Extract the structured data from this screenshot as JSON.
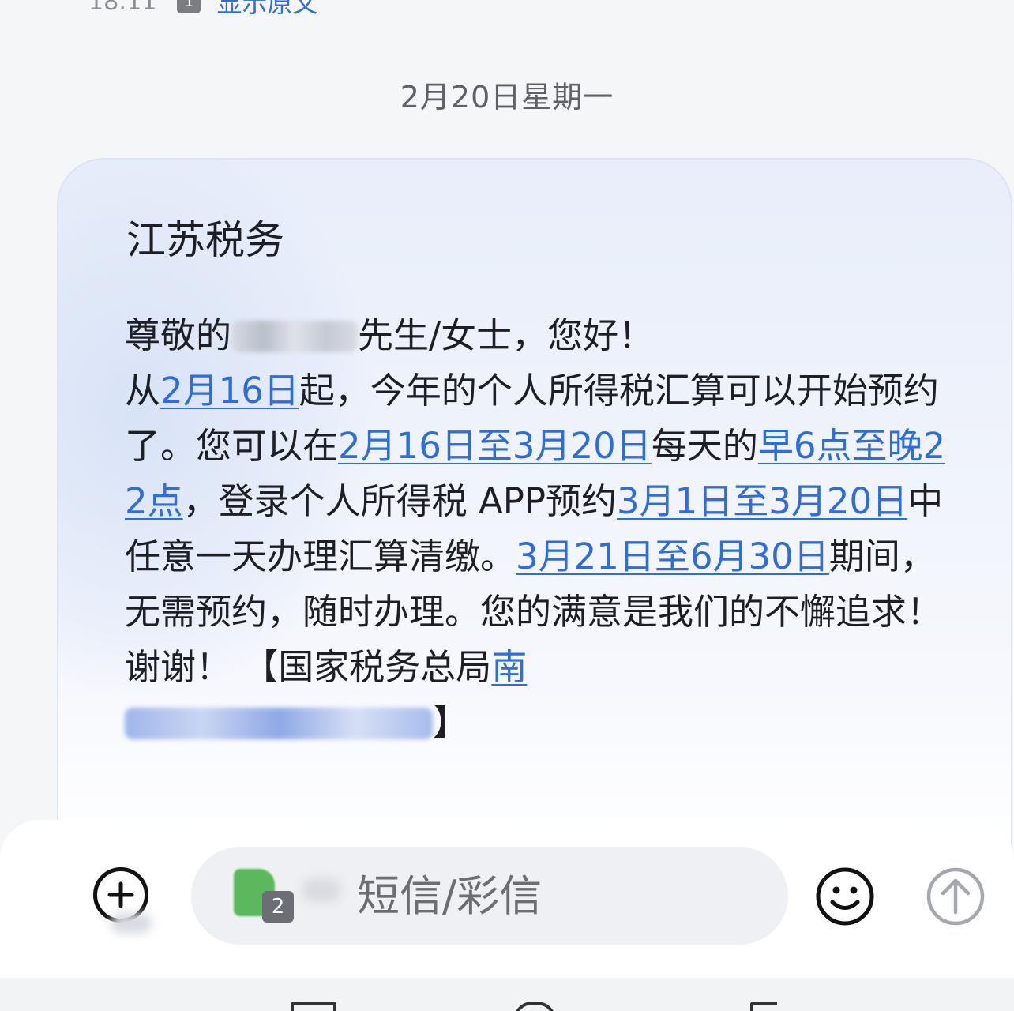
{
  "prev_message": {
    "time": "18:11",
    "sim": "1",
    "show_original": "显示原文"
  },
  "date_divider": "2月20日星期一",
  "message": {
    "sender": "江苏税务",
    "greeting_pre": "尊敬的",
    "greeting_post": "先生/女士，您好！",
    "s1_pre": "从",
    "s1_link": "2月16日",
    "s1_post": "起，今年的个人所得税汇算可以开始预约了。您可以在",
    "s2_link": "2月16日至3月20日",
    "s2_post": "每天的",
    "s3_link": "早6点至晚22点",
    "s3_post": "，登录个人所得税 APP预约",
    "s4_link": "3月1日至3月20日",
    "s4_post": "中任意一天办理汇算清缴。",
    "s5_link": "3月21日至6月30日",
    "s5_post": "期间，无需预约，随时办理。您的满意是我们的不懈追求！谢谢！ 【国家税务总局",
    "s6_link": "南",
    "closing": "】"
  },
  "compose": {
    "sim_number": "2",
    "placeholder": "短信/彩信"
  },
  "icons": {
    "add": "plus-circle-icon",
    "emoji": "smiley-icon",
    "send": "arrow-up-circle-icon"
  },
  "colors": {
    "link": "#2f6ddb",
    "text": "#1d1f24",
    "meta": "#5e6168"
  }
}
